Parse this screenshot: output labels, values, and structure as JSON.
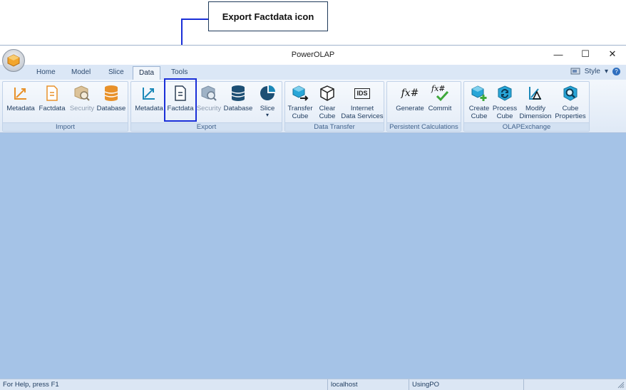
{
  "annotation": {
    "callout_text": "Export Factdata icon"
  },
  "window": {
    "title": "PowerOLAP",
    "controls": {
      "minimize": "—",
      "maximize": "☐",
      "close": "✕"
    }
  },
  "tabs": [
    "Home",
    "Model",
    "Slice",
    "Data",
    "Tools"
  ],
  "active_tab": "Data",
  "style_menu": {
    "label": "Style",
    "arrow": "▾",
    "help": "?"
  },
  "groups": {
    "import": {
      "label": "Import",
      "buttons": [
        {
          "label": "Metadata",
          "icon": "metadata-axis-icon",
          "enabled": true
        },
        {
          "label": "Factdata",
          "icon": "factdata-document-icon",
          "enabled": true
        },
        {
          "label": "Security",
          "icon": "security-cube-icon",
          "enabled": false
        },
        {
          "label": "Database",
          "icon": "database-cylinder-icon",
          "enabled": true
        }
      ]
    },
    "export": {
      "label": "Export",
      "buttons": [
        {
          "label": "Metadata",
          "icon": "metadata-axis-icon",
          "enabled": true
        },
        {
          "label": "Factdata",
          "icon": "factdata-document-icon",
          "enabled": true
        },
        {
          "label": "Security",
          "icon": "security-cube-icon",
          "enabled": false
        },
        {
          "label": "Database",
          "icon": "database-cylinder-icon",
          "enabled": true
        },
        {
          "label": "Slice",
          "icon": "slice-pie-icon",
          "enabled": true,
          "dropdown": "▾"
        }
      ]
    },
    "data_transfer": {
      "label": "Data Transfer",
      "buttons": [
        {
          "label_1": "Transfer",
          "label_2": "Cube",
          "icon": "transfer-cube-icon"
        },
        {
          "label_1": "Clear",
          "label_2": "Cube",
          "icon": "clear-cube-icon"
        },
        {
          "label_1": "Internet",
          "label_2": "Data Services",
          "icon": "ids-icon",
          "icon_text": "IDS"
        }
      ]
    },
    "persistent_calculations": {
      "label": "Persistent Calculations",
      "buttons": [
        {
          "label": "Generate",
          "icon": "fx-generate-icon",
          "icon_text": "fx#"
        },
        {
          "label": "Commit",
          "icon": "fx-commit-icon",
          "icon_text": "fx#"
        }
      ]
    },
    "olap_exchange": {
      "label": "OLAPExchange",
      "buttons": [
        {
          "label_1": "Create",
          "label_2": "Cube",
          "icon": "create-cube-icon"
        },
        {
          "label_1": "Process",
          "label_2": "Cube",
          "icon": "process-cube-icon"
        },
        {
          "label_1": "Modify",
          "label_2": "Dimension",
          "icon": "modify-dimension-icon"
        },
        {
          "label_1": "Cube",
          "label_2": "Properties",
          "icon": "cube-properties-icon"
        }
      ]
    }
  },
  "statusbar": {
    "help": "For Help, press F1",
    "server": "localhost",
    "user": "UsingPO"
  },
  "colors": {
    "workspace": "#a5c3e7",
    "highlight": "#1a2fd8",
    "accent_orange": "#e8912a",
    "accent_teal": "#1b88b8"
  }
}
